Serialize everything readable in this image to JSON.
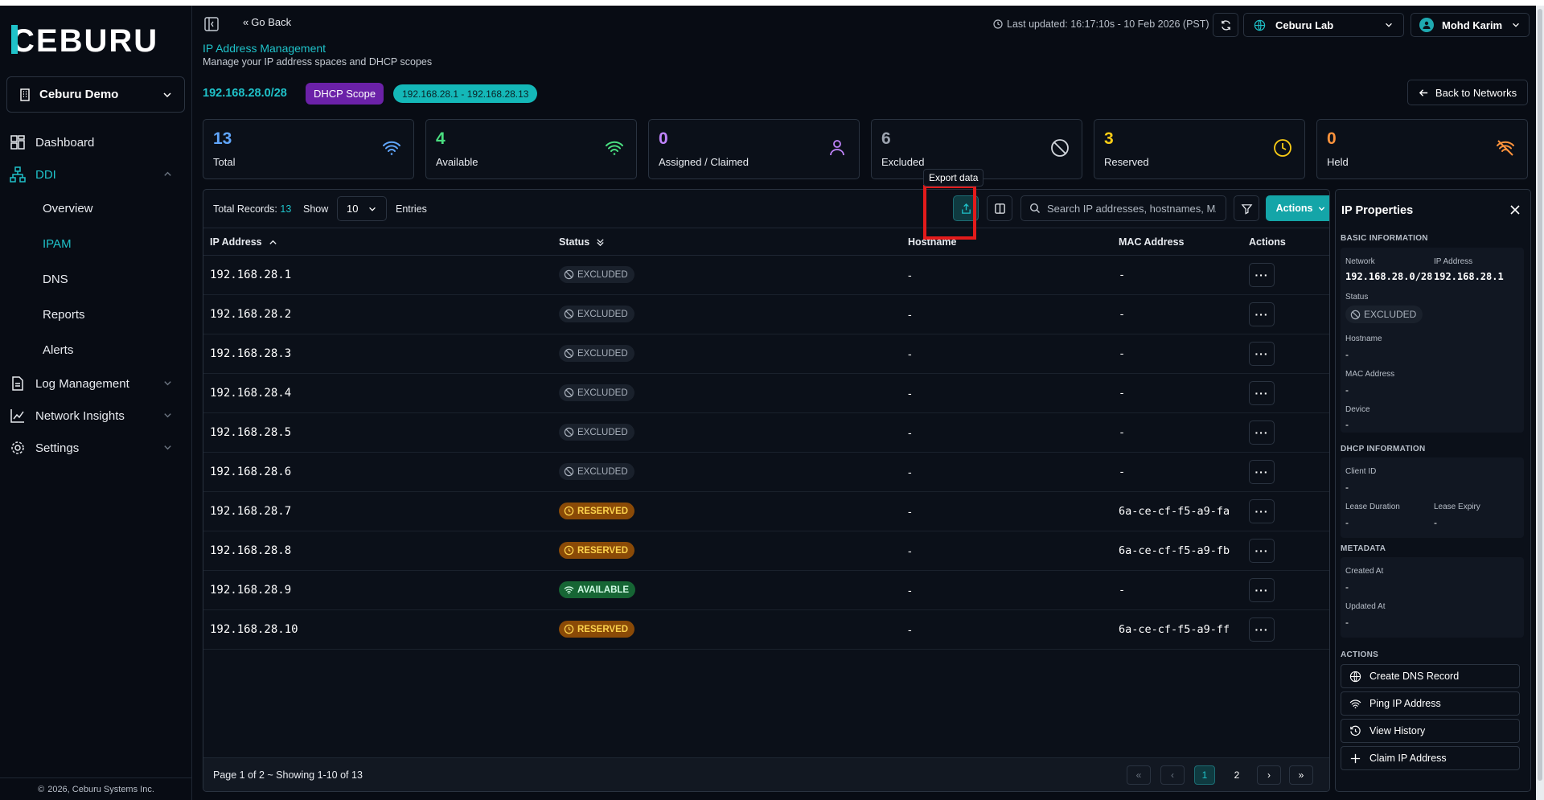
{
  "brand": {
    "logo_text": "CEBURU"
  },
  "sidebar": {
    "org": "Ceburu Demo",
    "items": [
      {
        "label": "Dashboard"
      },
      {
        "label": "DDI"
      },
      {
        "label": "Log Management"
      },
      {
        "label": "Network Insights"
      },
      {
        "label": "Settings"
      }
    ],
    "ddi_sub": [
      "Overview",
      "IPAM",
      "DNS",
      "Reports",
      "Alerts"
    ],
    "active_sub": "IPAM",
    "copyright": "2026, Ceburu Systems Inc."
  },
  "header": {
    "go_back": "Go Back",
    "last_updated": "Last updated: 16:17:10s - 10 Feb 2026 (PST)",
    "lab": "Ceburu Lab",
    "user": "Mohd Karim"
  },
  "page": {
    "title": "IP Address Management",
    "subtitle": "Manage your IP address spaces and DHCP scopes",
    "network": "192.168.28.0/28",
    "scope_badge": "DHCP Scope",
    "range_badge": "192.168.28.1 - 192.168.28.13",
    "back_button": "Back to Networks"
  },
  "stats": [
    {
      "value": "13",
      "label": "Total",
      "color": "#60a5fa",
      "icon": "wifi-icon"
    },
    {
      "value": "4",
      "label": "Available",
      "color": "#4ade80",
      "icon": "wifi-icon"
    },
    {
      "value": "0",
      "label": "Assigned / Claimed",
      "color": "#c084fc",
      "icon": "user-icon"
    },
    {
      "value": "6",
      "label": "Excluded",
      "color": "#9ca3af",
      "icon": "ban-icon"
    },
    {
      "value": "3",
      "label": "Reserved",
      "color": "#facc15",
      "icon": "clock-icon"
    },
    {
      "value": "0",
      "label": "Held",
      "color": "#fb923c",
      "icon": "wifi-off-icon"
    }
  ],
  "toolbar": {
    "total_label": "Total Records:",
    "total_count": "13",
    "show_label": "Show",
    "page_size": "10",
    "entries_label": "Entries",
    "export_tooltip": "Export data",
    "search_placeholder": "Search IP addresses, hostnames, MAC addresses...",
    "actions_label": "Actions"
  },
  "table": {
    "columns": [
      "IP Address",
      "Status",
      "Hostname",
      "MAC Address",
      "Actions"
    ],
    "rows": [
      {
        "ip": "192.168.28.1",
        "status": "EXCLUDED",
        "host": "-",
        "mac": "-"
      },
      {
        "ip": "192.168.28.2",
        "status": "EXCLUDED",
        "host": "-",
        "mac": "-"
      },
      {
        "ip": "192.168.28.3",
        "status": "EXCLUDED",
        "host": "-",
        "mac": "-"
      },
      {
        "ip": "192.168.28.4",
        "status": "EXCLUDED",
        "host": "-",
        "mac": "-"
      },
      {
        "ip": "192.168.28.5",
        "status": "EXCLUDED",
        "host": "-",
        "mac": "-"
      },
      {
        "ip": "192.168.28.6",
        "status": "EXCLUDED",
        "host": "-",
        "mac": "-"
      },
      {
        "ip": "192.168.28.7",
        "status": "RESERVED",
        "host": "-",
        "mac": "6a-ce-cf-f5-a9-fa"
      },
      {
        "ip": "192.168.28.8",
        "status": "RESERVED",
        "host": "-",
        "mac": "6a-ce-cf-f5-a9-fb"
      },
      {
        "ip": "192.168.28.9",
        "status": "AVAILABLE",
        "host": "-",
        "mac": "-"
      },
      {
        "ip": "192.168.28.10",
        "status": "RESERVED",
        "host": "-",
        "mac": "6a-ce-cf-f5-a9-ff"
      }
    ]
  },
  "pagination": {
    "info": "Page 1 of 2 ~ Showing 1-10 of 13",
    "pages": [
      "1",
      "2"
    ],
    "current": "1"
  },
  "props": {
    "title": "IP Properties",
    "basic_heading": "BASIC INFORMATION",
    "network_label": "Network",
    "network_value": "192.168.28.0/28",
    "ip_label": "IP Address",
    "ip_value": "192.168.28.1",
    "status_label": "Status",
    "status_value": "EXCLUDED",
    "hostname_label": "Hostname",
    "hostname_value": "-",
    "mac_label": "MAC Address",
    "mac_value": "-",
    "device_label": "Device",
    "device_value": "-",
    "dhcp_heading": "DHCP INFORMATION",
    "client_label": "Client ID",
    "client_value": "-",
    "lease_dur_label": "Lease Duration",
    "lease_dur_value": "-",
    "lease_exp_label": "Lease Expiry",
    "lease_exp_value": "-",
    "meta_heading": "METADATA",
    "created_label": "Created At",
    "created_value": "-",
    "updated_label": "Updated At",
    "updated_value": "-",
    "actions_heading": "ACTIONS",
    "actions": [
      "Create DNS Record",
      "Ping IP Address",
      "View History",
      "Claim IP Address"
    ]
  }
}
